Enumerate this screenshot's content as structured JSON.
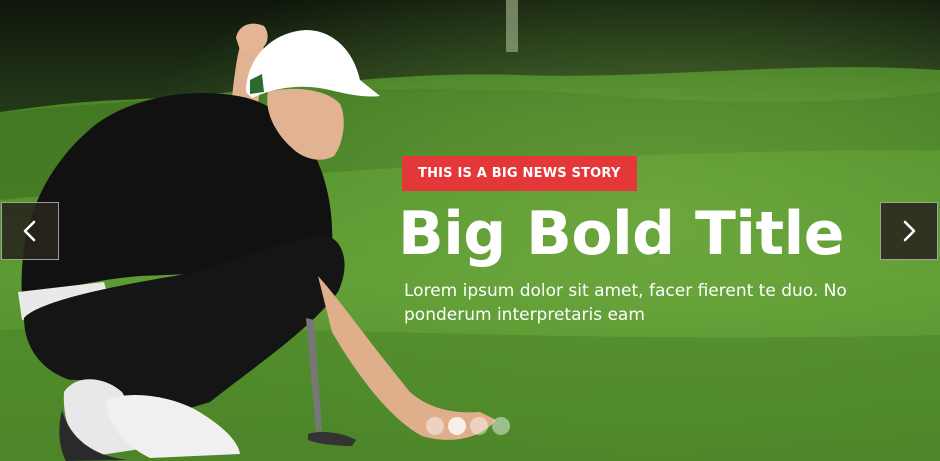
{
  "slider": {
    "tag": "THIS IS A BIG NEWS STORY",
    "title": "Big Bold Title",
    "description": "Lorem ipsum dolor sit amet, facer fierent te duo. No ponderum interpretaris eam",
    "prev_icon": "chevron-left-icon",
    "next_icon": "chevron-right-icon",
    "dots_count": 4,
    "active_dot": 2,
    "accent_color": "#e4373a"
  }
}
